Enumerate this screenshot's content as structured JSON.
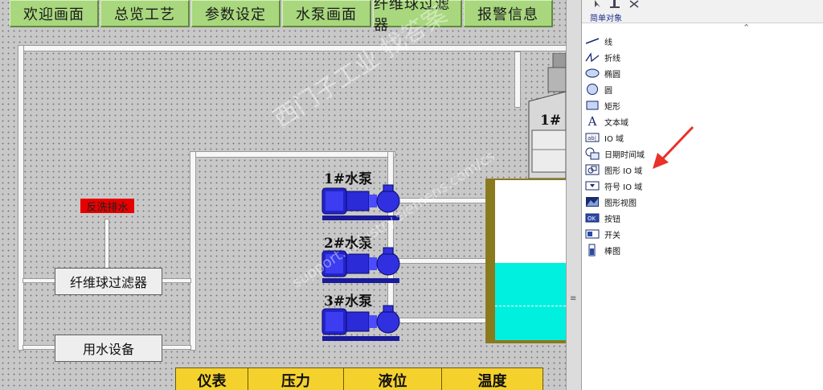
{
  "nav": {
    "items": [
      "欢迎画面",
      "总览工艺",
      "参数设定",
      "水泵画面",
      "纤维球过滤器",
      "报警信息"
    ]
  },
  "process": {
    "backwash_label": "反洗排水",
    "filter_label": "纤维球过滤器",
    "water_equipment_label": "用水设备",
    "pumps": [
      "1#水泵",
      "2#水泵",
      "3#水泵"
    ],
    "tower_label": "1#",
    "tank_level_percent": 48,
    "table_headers": [
      "仪表",
      "压力",
      "液位",
      "温度"
    ]
  },
  "watermark": {
    "text": "西门子工业  找答案",
    "url": "support.industry.siemens.com/cs"
  },
  "toolbox": {
    "heading": "简单对象",
    "items": [
      {
        "label": "线",
        "icon": "line-icon"
      },
      {
        "label": "折线",
        "icon": "polyline-icon"
      },
      {
        "label": "椭圆",
        "icon": "ellipse-icon"
      },
      {
        "label": "圆",
        "icon": "circle-icon"
      },
      {
        "label": "矩形",
        "icon": "rectangle-icon"
      },
      {
        "label": "文本域",
        "icon": "text-field-icon"
      },
      {
        "label": "IO 域",
        "icon": "io-field-icon"
      },
      {
        "label": "日期时间域",
        "icon": "date-time-field-icon"
      },
      {
        "label": "图形 IO 域",
        "icon": "graphic-io-field-icon"
      },
      {
        "label": "符号 IO 域",
        "icon": "symbolic-io-field-icon"
      },
      {
        "label": "图形视图",
        "icon": "graphic-view-icon"
      },
      {
        "label": "按钮",
        "icon": "button-icon"
      },
      {
        "label": "开关",
        "icon": "switch-icon"
      },
      {
        "label": "棒图",
        "icon": "bar-graph-icon"
      }
    ]
  },
  "colors": {
    "nav_button": "#a8d77e",
    "tank_water": "#00f0e0",
    "alarm_red": "#e60000",
    "table_yellow": "#f5d12e",
    "annotation_arrow": "#e8312a"
  }
}
